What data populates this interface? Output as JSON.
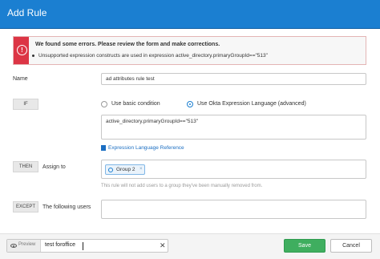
{
  "dialog": {
    "title": "Add Rule"
  },
  "error": {
    "heading": "We found some errors. Please review the form and make corrections.",
    "items": [
      "Unsupported expression constructs are used in expression active_directory.primaryGroupId==\"513\""
    ]
  },
  "name": {
    "label": "Name",
    "value": "ad attributes rule test"
  },
  "if": {
    "tag": "IF",
    "options": [
      "Use basic condition",
      "Use Okta Expression Language (advanced)"
    ],
    "selected": "Use Okta Expression Language (advanced)",
    "expression": "active_directory.primaryGroupId==\"513\"",
    "reference_link": "Expression Language Reference"
  },
  "then": {
    "tag": "THEN",
    "label": "Assign to",
    "groups": [
      "Group 2"
    ],
    "remove_glyph": "×",
    "note": "This rule will not add users to a group they've been manually removed from."
  },
  "except": {
    "tag": "EXCEPT",
    "label": "The following users",
    "value": ""
  },
  "footer": {
    "preview_label": "Preview",
    "preview_value": "test foroffice",
    "clear_glyph": "✕",
    "save": "Save",
    "cancel": "Cancel"
  },
  "colors": {
    "titlebar": "#1b7fd1",
    "error": "#dc3545",
    "save": "#3fae5f"
  },
  "icons": [
    "error-icon",
    "document-icon",
    "group-icon",
    "eye-icon",
    "clear-icon"
  ]
}
